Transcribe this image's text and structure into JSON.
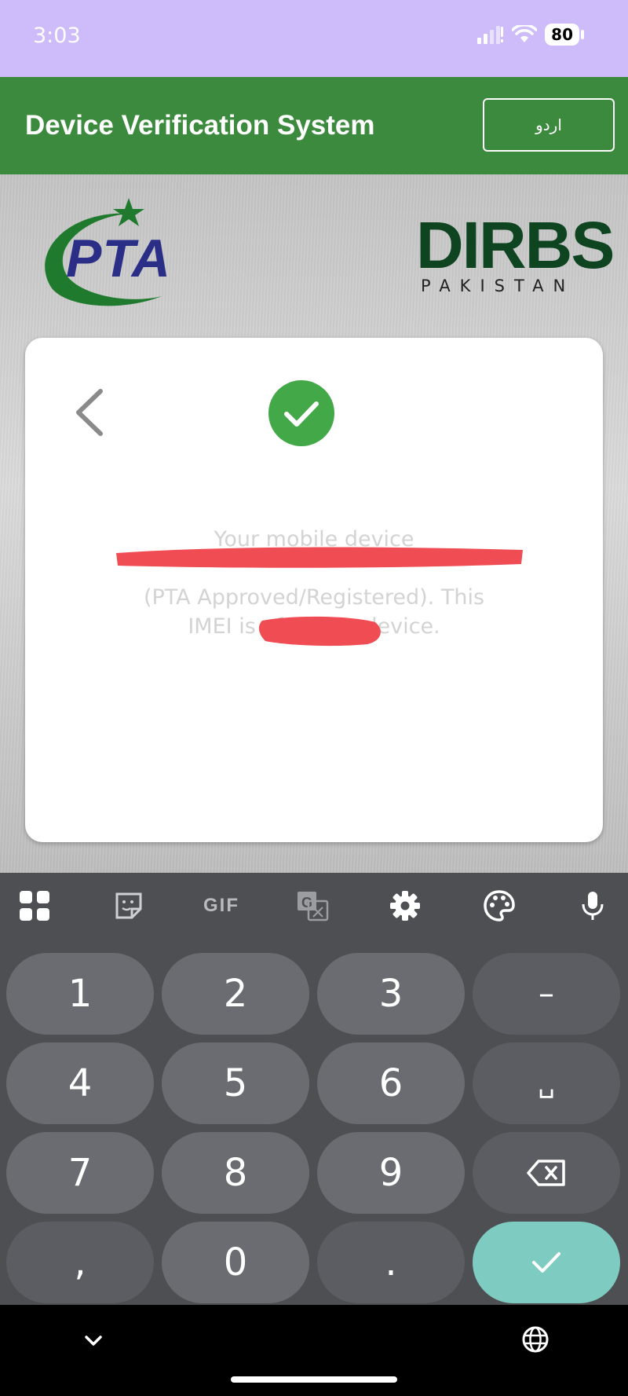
{
  "status_bar": {
    "time": "3:03",
    "battery": "80"
  },
  "app_bar": {
    "title": "Device Verification System",
    "language_button": "اردو"
  },
  "logos": {
    "pta": "PTA",
    "dirbs_main": "DIRBS",
    "dirbs_sub": "PAKISTAN"
  },
  "result": {
    "message_lines": [
      "Your mobile device",
      "",
      "(PTA Approved/Registered). This",
      "IMEI is of            device."
    ]
  },
  "keyboard": {
    "toolbar": [
      "apps-grid-icon",
      "sticker-icon",
      "GIF",
      "translate-icon",
      "gear-icon",
      "palette-icon",
      "microphone-icon"
    ],
    "gif_label": "GIF",
    "keys": {
      "k1": "1",
      "k2": "2",
      "k3": "3",
      "dash": "–",
      "k4": "4",
      "k5": "5",
      "k6": "6",
      "space": "␣",
      "k7": "7",
      "k8": "8",
      "k9": "9",
      "comma": ",",
      "k0": "0",
      "period": "."
    }
  },
  "colors": {
    "status_bar": "#cdbcf9",
    "app_bar": "#3c8a3e",
    "success": "#43a847",
    "enter_key": "#7ecbc2",
    "pta_blue": "#2b2e86",
    "pta_green": "#1f7a2e",
    "dirbs_green": "#0f4420",
    "redaction": "#f04c54"
  }
}
